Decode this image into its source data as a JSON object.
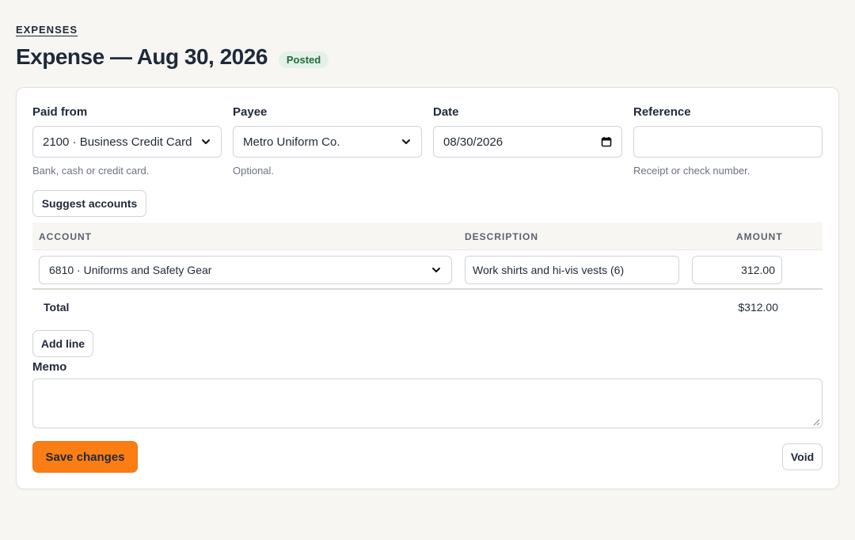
{
  "breadcrumb": "EXPENSES",
  "header": {
    "title": "Expense — Aug 30, 2026",
    "status": "Posted"
  },
  "form": {
    "paid_from": {
      "label": "Paid from",
      "value": "2100 · Business Credit Card",
      "help": "Bank, cash or credit card."
    },
    "payee": {
      "label": "Payee",
      "value": "Metro Uniform Co.",
      "help": "Optional."
    },
    "date": {
      "label": "Date",
      "value": "08/30/2026"
    },
    "reference": {
      "label": "Reference",
      "value": "",
      "help": "Receipt or check number."
    }
  },
  "buttons": {
    "suggest": "Suggest accounts",
    "add_line": "Add line",
    "save": "Save changes",
    "void": "Void"
  },
  "lines": {
    "columns": [
      "ACCOUNT",
      "DESCRIPTION",
      "AMOUNT"
    ],
    "rows": [
      {
        "account": "6810 · Uniforms and Safety Gear",
        "description": "Work shirts and hi-vis vests (6)",
        "amount": "312.00"
      }
    ],
    "total_label": "Total",
    "total_value": "$312.00"
  },
  "memo": {
    "label": "Memo",
    "value": ""
  },
  "colors": {
    "accent": "#fb7e14",
    "badge_bg": "#e3f1e6",
    "badge_text": "#216b3d",
    "page_bg": "#f7f6f3"
  }
}
